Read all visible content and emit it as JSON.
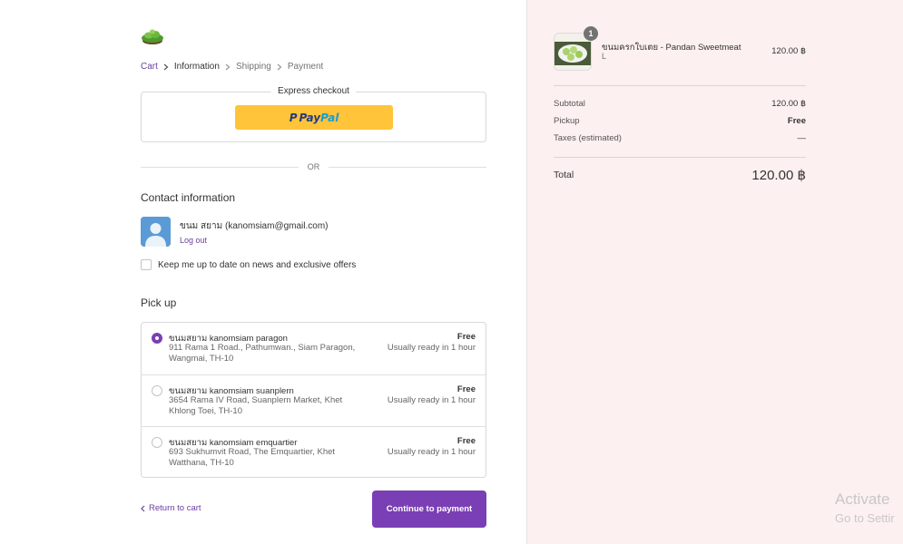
{
  "breadcrumb": {
    "cart": "Cart",
    "information": "Information",
    "shipping": "Shipping",
    "payment": "Payment"
  },
  "express": {
    "title": "Express checkout",
    "paypal_a": "Pay",
    "paypal_b": "Pal"
  },
  "divider": {
    "or": "OR"
  },
  "contact": {
    "title": "Contact information",
    "user": "ขนม สยาม (kanomsiam@gmail.com)",
    "logout": "Log out",
    "newsletter": "Keep me up to date on news and exclusive offers"
  },
  "pickup": {
    "title": "Pick up",
    "locations": [
      {
        "name": "ขนมสยาม kanomsiam paragon",
        "address": "911 Rama 1 Road., Pathumwan., Siam Paragon, Wangmai, TH-10",
        "price": "Free",
        "ready": "Usually ready in 1 hour",
        "selected": true
      },
      {
        "name": "ขนมสยาม kanomsiam suanplern",
        "address": "3654 Rama IV Road, Suanplern Market, Khet Khlong Toei, TH-10",
        "price": "Free",
        "ready": "Usually ready in 1 hour",
        "selected": false
      },
      {
        "name": "ขนมสยาม kanomsiam emquartier",
        "address": "693 Sukhumvit Road, The Emquartier, Khet Watthana, TH-10",
        "price": "Free",
        "ready": "Usually ready in 1 hour",
        "selected": false
      }
    ]
  },
  "footer": {
    "return": "Return to cart",
    "continue": "Continue to payment"
  },
  "summary": {
    "product": {
      "name": "ขนมครกใบเตย - Pandan Sweetmeat",
      "variant": "L",
      "price": "120.00 ฿",
      "quantity": "1"
    },
    "subtotal_label": "Subtotal",
    "subtotal_value": "120.00 ฿",
    "pickup_label": "Pickup",
    "pickup_value": "Free",
    "taxes_label": "Taxes (estimated)",
    "taxes_value": "—",
    "total_label": "Total",
    "total_value": "120.00 ฿"
  },
  "watermark": {
    "line1": "Activate",
    "line2": "Go to Settir"
  },
  "colors": {
    "accent": "#7b3fb5",
    "link": "#6b3fa0",
    "paypal": "#ffc439",
    "sidebar_bg": "#fdf0f0"
  },
  "icons": {
    "logo": "grass-island-logo",
    "breadcrumb_sep": "chevron-right-icon",
    "return": "chevron-left-icon",
    "avatar": "user-silhouette-icon",
    "product": "pandan-sweetmeat-thumbnail"
  }
}
